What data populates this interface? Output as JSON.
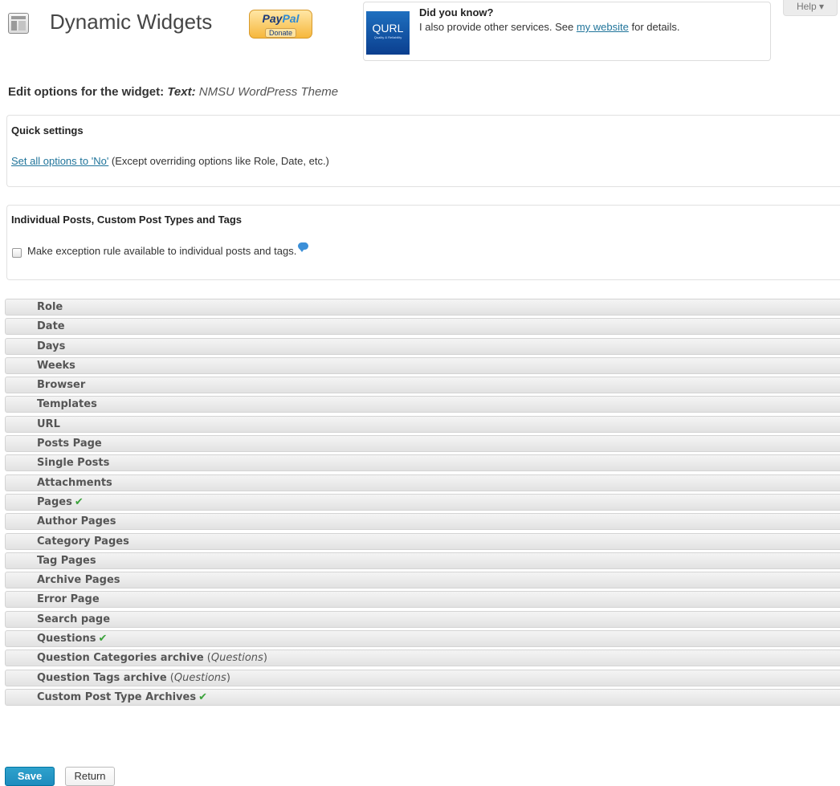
{
  "header": {
    "title": "Dynamic Widgets",
    "paypal": {
      "brand_part1": "Pay",
      "brand_part2": "Pal",
      "action": "Donate"
    },
    "help_tab": "Help ▾"
  },
  "info_box": {
    "logo_text": "QURL",
    "logo_subtext": "Quality & Reliability",
    "heading": "Did you know?",
    "text_before": "I also provide other services. See ",
    "link": "my website",
    "text_after": " for details."
  },
  "edit_heading": {
    "prefix": "Edit options for the widget: ",
    "widget_type": "Text:",
    "widget_name": " NMSU WordPress Theme"
  },
  "quick_settings": {
    "title": "Quick settings",
    "link": "Set all options to 'No'",
    "note": " (Except overriding options like Role, Date, etc.)"
  },
  "individual": {
    "title": "Individual Posts, Custom Post Types and Tags",
    "checkbox_label": "Make exception rule available to individual posts and tags.",
    "checked": false
  },
  "options": [
    {
      "label": "Role",
      "checked": false
    },
    {
      "label": "Date",
      "checked": false
    },
    {
      "label": "Days",
      "checked": false
    },
    {
      "label": "Weeks",
      "checked": false
    },
    {
      "label": "Browser",
      "checked": false
    },
    {
      "label": "Templates",
      "checked": false
    },
    {
      "label": "URL",
      "checked": false
    },
    {
      "label": "Posts Page",
      "checked": false
    },
    {
      "label": "Single Posts",
      "checked": false
    },
    {
      "label": "Attachments",
      "checked": false
    },
    {
      "label": "Pages",
      "checked": true
    },
    {
      "label": "Author Pages",
      "checked": false
    },
    {
      "label": "Category Pages",
      "checked": false
    },
    {
      "label": "Tag Pages",
      "checked": false
    },
    {
      "label": "Archive Pages",
      "checked": false
    },
    {
      "label": "Error Page",
      "checked": false
    },
    {
      "label": "Search page",
      "checked": false
    },
    {
      "label": "Questions",
      "checked": true
    },
    {
      "label": "Question Categories archive",
      "qualifier": "Questions",
      "checked": false
    },
    {
      "label": "Question Tags archive",
      "qualifier": "Questions",
      "checked": false
    },
    {
      "label": "Custom Post Type Archives",
      "checked": true
    }
  ],
  "footer": {
    "save_label": "Save",
    "return_label": "Return"
  },
  "colors": {
    "link": "#21759b",
    "checkmark": "#3aa23a",
    "save_button": "#2ea2cc"
  }
}
